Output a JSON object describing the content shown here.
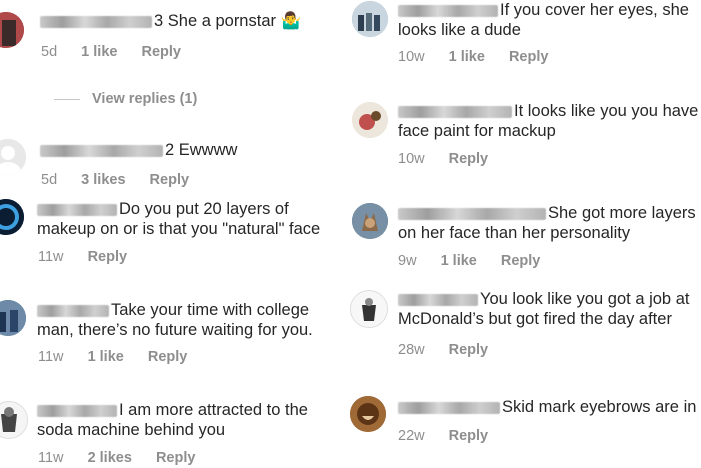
{
  "left_comments": [
    {
      "text": "3 She a pornstar 🤷‍♂️",
      "time": "5d",
      "likes": "1 like",
      "reply": "Reply",
      "avatar_color": "#7a3b3b",
      "view_replies": "View replies (1)"
    },
    {
      "text": "2 Ewwww",
      "time": "5d",
      "likes": "3 likes",
      "reply": "Reply",
      "avatar_color": "#dbdbdb"
    },
    {
      "line1": "Do you put 20 layers of",
      "line2": "makeup on or is that you \"natural\" face",
      "time": "11w",
      "reply": "Reply",
      "avatar_color": "#0f2a4a"
    },
    {
      "line1": "Take your time with college",
      "line2": "man, there’s no future waiting for you.",
      "time": "11w",
      "likes": "1 like",
      "reply": "Reply",
      "avatar_color": "#3c5a7a"
    },
    {
      "line1": "I am more attracted to the",
      "line2": "soda machine behind you",
      "time": "11w",
      "likes": "2 likes",
      "reply": "Reply",
      "avatar_color": "#f2f2f2"
    }
  ],
  "right_comments": [
    {
      "line1": "If you cover her eyes, she",
      "line2": "looks like a dude",
      "time": "10w",
      "likes": "1 like",
      "reply": "Reply",
      "avatar_color": "#8aa0b5"
    },
    {
      "line1": "It looks like you you have",
      "line2": "face paint for  mackup",
      "time": "10w",
      "reply": "Reply",
      "avatar_color": "#c0504d"
    },
    {
      "line1": "She got more layers",
      "line2": "on her face than her personality",
      "time": "9w",
      "likes": "1 like",
      "reply": "Reply",
      "avatar_color": "#5a6a7a"
    },
    {
      "line1": "You look like you got a job at",
      "line2": "McDonald’s but got fired the day after",
      "time": "28w",
      "reply": "Reply",
      "avatar_color": "#f2f2f2"
    },
    {
      "line1": "Skid mark eyebrows are in",
      "time": "22w",
      "reply": "Reply",
      "avatar_color": "#8a5a2a"
    }
  ]
}
